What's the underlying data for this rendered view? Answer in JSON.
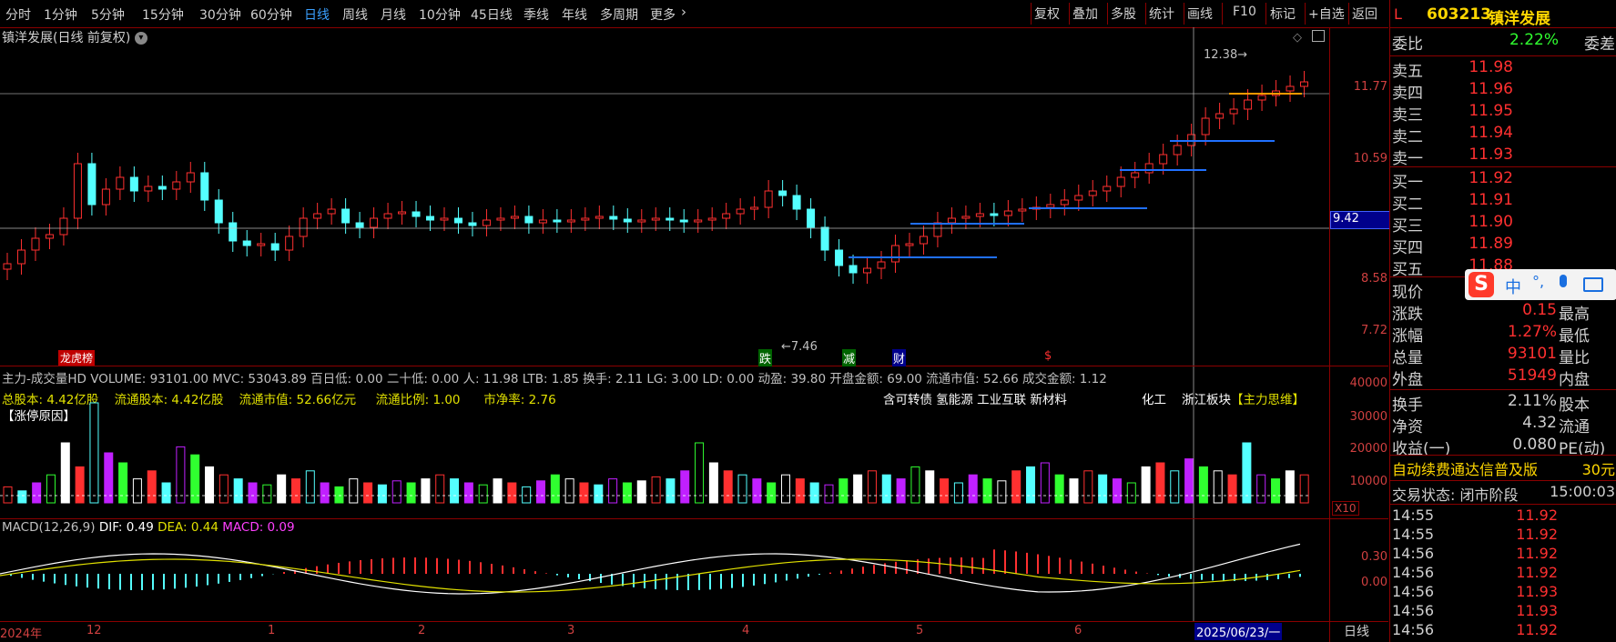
{
  "toolbar": {
    "periods": [
      "分时",
      "1分钟",
      "5分钟",
      "15分钟",
      "30分钟",
      "60分钟",
      "日线",
      "周线",
      "月线",
      "10分钟",
      "45日线",
      "季线",
      "年线",
      "多周期",
      "更多"
    ],
    "active_period": "日线",
    "more_icon": "chevron-right-icon",
    "right_buttons": [
      "复权",
      "叠加",
      "多股",
      "统计",
      "画线",
      "F10",
      "标记",
      "+自选",
      "返回"
    ]
  },
  "chart": {
    "title": "镇洋发展(日线 前复权)",
    "title_icon": "chevron-down-icon",
    "top_icons": [
      "diamond-icon",
      "window-icon"
    ],
    "price_axis": [
      "11.77",
      "10.59",
      "9.42",
      "8.58",
      "7.72"
    ],
    "crosshair_price": "9.42",
    "high_mark": "12.38",
    "low_mark": "7.46",
    "event_markers": [
      "龙虎榜",
      "跌",
      "减",
      "财",
      "$"
    ],
    "volume_info": "主力-成交量HD VOLUME: 93101.00 MVC: 53043.89 百日低: 0.00 二十低: 0.00 人: 11.98 LTB: 1.85 换手: 2.11 LG: 3.00 LD: 0.00 动盈: 39.80 开盘金额: 69.00 流通市值: 52.66 成交金额: 1.12",
    "fundamentals": [
      "总股本: 4.42亿股",
      "流通股本: 4.42亿股",
      "流通市值: 52.66亿元",
      "流通比例: 1.00",
      "市净率: 2.76"
    ],
    "concepts": "含可转债 氢能源 工业互联 新材料",
    "industry": "化工",
    "region_block": "浙江板块",
    "main_thought": "【主力思维】",
    "limit_reason": "【涨停原因】",
    "volume_axis": [
      "40000",
      "30000",
      "20000",
      "10000"
    ],
    "volume_unit": "X10",
    "macd_info": {
      "name": "MACD(12,26,9)",
      "dif": "DIF: 0.49",
      "dea": "DEA: 0.44",
      "macd": "MACD: 0.09"
    },
    "macd_axis": [
      "0.30",
      "0.00"
    ],
    "date_labels": [
      "2024年",
      "12",
      "1",
      "2",
      "3",
      "4",
      "5",
      "6"
    ],
    "cursor_date": "2025/06/23/一",
    "period_label": "日线"
  },
  "panel": {
    "code": "603213",
    "name": "镇洋发展",
    "marker": "L",
    "weibi_label": "委比",
    "weibi_value": "2.22%",
    "weicha_label": "委差",
    "sells": [
      {
        "label": "卖五",
        "price": "11.98"
      },
      {
        "label": "卖四",
        "price": "11.96"
      },
      {
        "label": "卖三",
        "price": "11.95"
      },
      {
        "label": "卖二",
        "price": "11.94"
      },
      {
        "label": "卖一",
        "price": "11.93"
      }
    ],
    "buys": [
      {
        "label": "买一",
        "price": "11.92"
      },
      {
        "label": "买二",
        "price": "11.91"
      },
      {
        "label": "买三",
        "price": "11.90"
      },
      {
        "label": "买四",
        "price": "11.89"
      },
      {
        "label": "买五",
        "price": "11.88"
      }
    ],
    "stats": [
      {
        "l": "现价",
        "v": "",
        "l2": ""
      },
      {
        "l": "涨跌",
        "v": "0.15",
        "l2": "最高"
      },
      {
        "l": "涨幅",
        "v": "1.27%",
        "l2": "最低"
      },
      {
        "l": "总量",
        "v": "93101",
        "l2": "量比"
      },
      {
        "l": "外盘",
        "v": "51949",
        "l2": "内盘"
      }
    ],
    "stats2": [
      {
        "l": "换手",
        "v": "2.11%",
        "l2": "股本"
      },
      {
        "l": "净资",
        "v": "4.32",
        "l2": "流通"
      },
      {
        "l": "收益(一)",
        "v": "0.080",
        "l2": "PE(动)"
      }
    ],
    "ad_text": "自动续费通达信普及版",
    "ad_price": "30元",
    "trade_state": "交易状态: 闭市阶段",
    "trade_time": "15:00:03",
    "ticks": [
      {
        "t": "14:55",
        "p": "11.92"
      },
      {
        "t": "14:55",
        "p": "11.92"
      },
      {
        "t": "14:56",
        "p": "11.92"
      },
      {
        "t": "14:56",
        "p": "11.92"
      },
      {
        "t": "14:56",
        "p": "11.93"
      },
      {
        "t": "14:56",
        "p": "11.93"
      },
      {
        "t": "14:56",
        "p": "11.92"
      }
    ],
    "ime_logo": "S",
    "ime_items": [
      "中",
      "°,",
      "mic-icon",
      "keyboard-icon"
    ]
  },
  "colors": {
    "up": "#ff3030",
    "down": "#54ffff",
    "purple": "#c020ff",
    "frame": "#8b0000",
    "ma": "#e0e000"
  }
}
